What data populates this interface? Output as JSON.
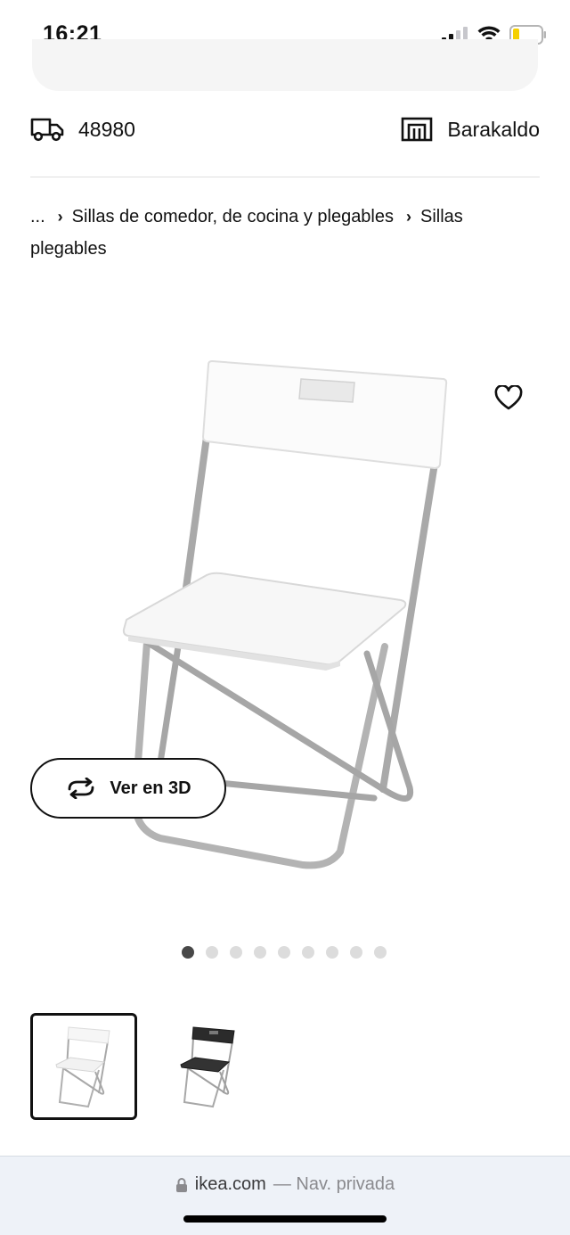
{
  "status_bar": {
    "time": "16:21"
  },
  "location": {
    "postal_code": "48980",
    "store": "Barakaldo"
  },
  "breadcrumb": {
    "ellipsis": "...",
    "items": [
      "Sillas de comedor, de cocina y plegables",
      "Sillas plegables"
    ]
  },
  "product": {
    "view_3d_label": "Ver en 3D",
    "image_dots_count": 9,
    "active_dot": 0
  },
  "browser": {
    "domain": "ikea.com",
    "private_label": "— Nav. privada"
  },
  "colors": {
    "accent": "#111111",
    "dot_active": "#484848",
    "dot_inactive": "#dcdcdc"
  }
}
